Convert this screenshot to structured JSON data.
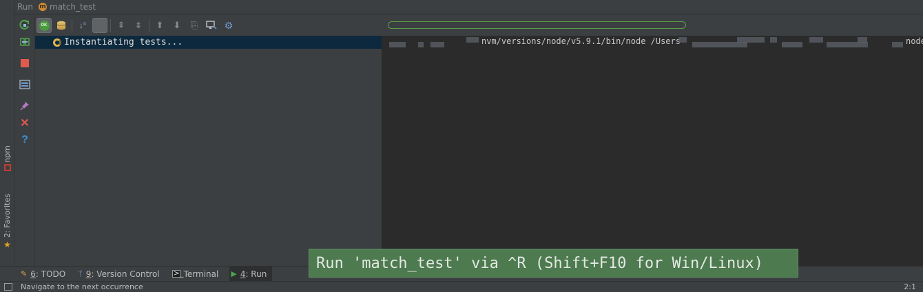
{
  "header": {
    "label": "Run",
    "config_badge": "m",
    "config_name": "match_test"
  },
  "left_stripe": {
    "npm_label": "npm",
    "favorites_label": "2: Favorites"
  },
  "test_tree": {
    "status_text": "Instantiating tests..."
  },
  "console": {
    "line_parts": [
      "nvm/versions/node/v5.9.1/bin/node /Users",
      "node"
    ]
  },
  "bottom_tabs": [
    {
      "key": "6",
      "label": ": TODO"
    },
    {
      "key": "9",
      "label": ": Version Control"
    },
    {
      "key": "",
      "label": "Terminal"
    },
    {
      "key": "4",
      "label": ": Run"
    }
  ],
  "tooltip": {
    "text": "Run 'match_test' via ^R (Shift+F10 for Win/Linux)"
  },
  "status": {
    "message": "Navigate to the next occurrence",
    "position": "2:1"
  },
  "toolbar": {
    "ok_badge": "OK"
  },
  "colors": {
    "accent_green": "#4d7a4f",
    "selection": "#0d293e",
    "stop_red": "#e05a4e",
    "progress_green": "#5a9f4a"
  }
}
